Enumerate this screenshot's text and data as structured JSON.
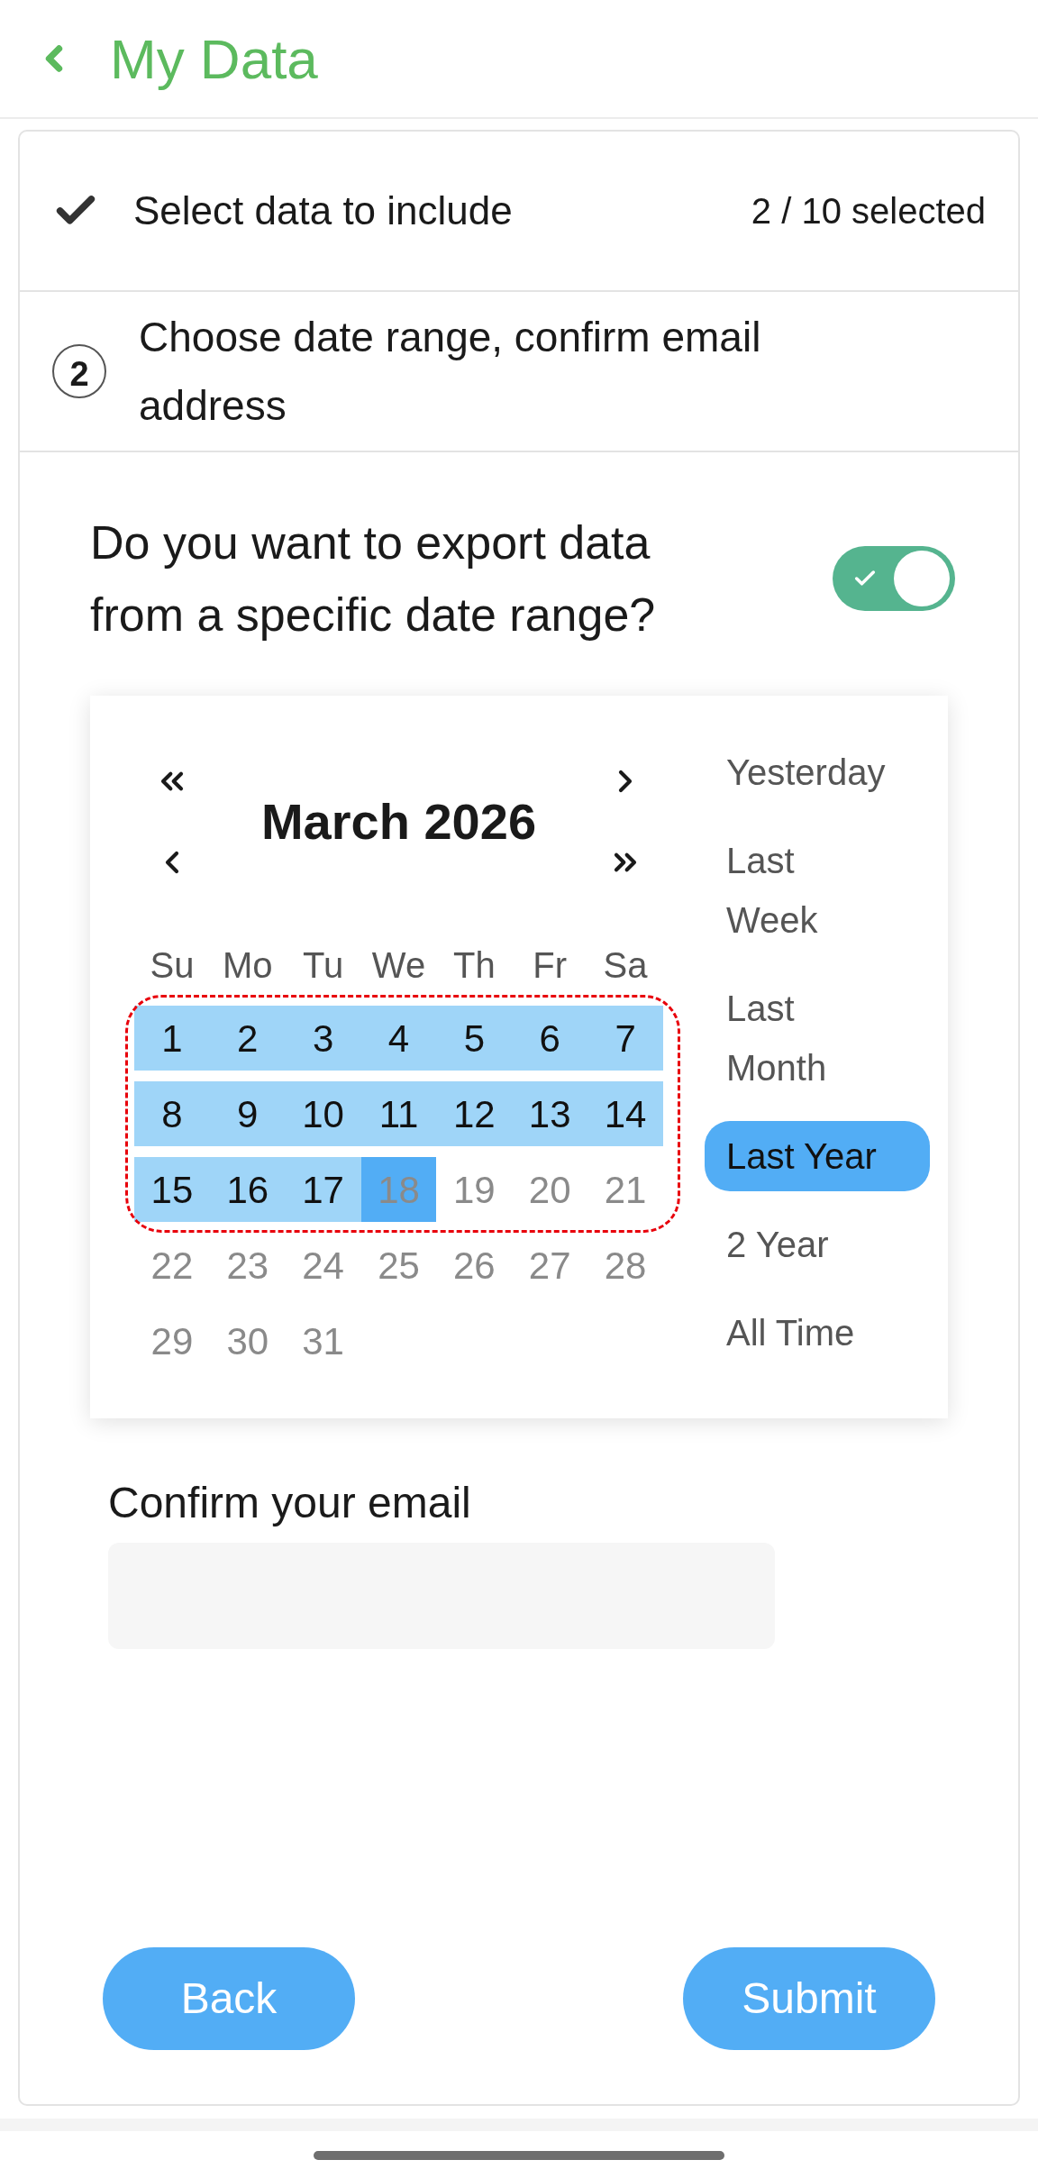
{
  "header": {
    "title": "My Data"
  },
  "steps": [
    {
      "kind": "done",
      "label": "Select data to include",
      "count": "2 / 10 selected"
    },
    {
      "kind": "current",
      "number": "2",
      "label": "Choose date range, confirm email address"
    }
  ],
  "date_range_question": {
    "label": "Do you want to export data from a specific date range?",
    "on": true
  },
  "calendar": {
    "month": "March 2026",
    "weekdays": [
      "Su",
      "Mo",
      "Tu",
      "We",
      "Th",
      "Fr",
      "Sa"
    ],
    "days": [
      {
        "label": "1",
        "in_range": true,
        "selected": false,
        "disabled": false
      },
      {
        "label": "2",
        "in_range": true,
        "selected": false,
        "disabled": false
      },
      {
        "label": "3",
        "in_range": true,
        "selected": false,
        "disabled": false
      },
      {
        "label": "4",
        "in_range": true,
        "selected": false,
        "disabled": false
      },
      {
        "label": "5",
        "in_range": true,
        "selected": false,
        "disabled": false
      },
      {
        "label": "6",
        "in_range": true,
        "selected": false,
        "disabled": false
      },
      {
        "label": "7",
        "in_range": true,
        "selected": false,
        "disabled": false
      },
      {
        "label": "8",
        "in_range": true,
        "selected": false,
        "disabled": false
      },
      {
        "label": "9",
        "in_range": true,
        "selected": false,
        "disabled": false
      },
      {
        "label": "10",
        "in_range": true,
        "selected": false,
        "disabled": false
      },
      {
        "label": "11",
        "in_range": true,
        "selected": false,
        "disabled": false
      },
      {
        "label": "12",
        "in_range": true,
        "selected": false,
        "disabled": false
      },
      {
        "label": "13",
        "in_range": true,
        "selected": false,
        "disabled": false
      },
      {
        "label": "14",
        "in_range": true,
        "selected": false,
        "disabled": false
      },
      {
        "label": "15",
        "in_range": true,
        "selected": false,
        "disabled": false
      },
      {
        "label": "16",
        "in_range": true,
        "selected": false,
        "disabled": false
      },
      {
        "label": "17",
        "in_range": true,
        "selected": false,
        "disabled": false
      },
      {
        "label": "18",
        "in_range": false,
        "selected": true,
        "disabled": true
      },
      {
        "label": "19",
        "in_range": false,
        "selected": false,
        "disabled": true
      },
      {
        "label": "20",
        "in_range": false,
        "selected": false,
        "disabled": true
      },
      {
        "label": "21",
        "in_range": false,
        "selected": false,
        "disabled": true
      },
      {
        "label": "22",
        "in_range": false,
        "selected": false,
        "disabled": true
      },
      {
        "label": "23",
        "in_range": false,
        "selected": false,
        "disabled": true
      },
      {
        "label": "24",
        "in_range": false,
        "selected": false,
        "disabled": true
      },
      {
        "label": "25",
        "in_range": false,
        "selected": false,
        "disabled": true
      },
      {
        "label": "26",
        "in_range": false,
        "selected": false,
        "disabled": true
      },
      {
        "label": "27",
        "in_range": false,
        "selected": false,
        "disabled": true
      },
      {
        "label": "28",
        "in_range": false,
        "selected": false,
        "disabled": true
      },
      {
        "label": "29",
        "in_range": false,
        "selected": false,
        "disabled": true
      },
      {
        "label": "30",
        "in_range": false,
        "selected": false,
        "disabled": true
      },
      {
        "label": "31",
        "in_range": false,
        "selected": false,
        "disabled": true
      }
    ],
    "presets": [
      {
        "label": "Yesterday",
        "selected": false
      },
      {
        "label": "Last Week",
        "selected": false
      },
      {
        "label": "Last Month",
        "selected": false
      },
      {
        "label": "Last Year",
        "selected": true
      },
      {
        "label": "2 Year",
        "selected": false
      },
      {
        "label": "All Time",
        "selected": false
      }
    ]
  },
  "email": {
    "label": "Confirm your email"
  },
  "buttons": [
    {
      "label": "Back"
    },
    {
      "label": "Submit"
    }
  ]
}
